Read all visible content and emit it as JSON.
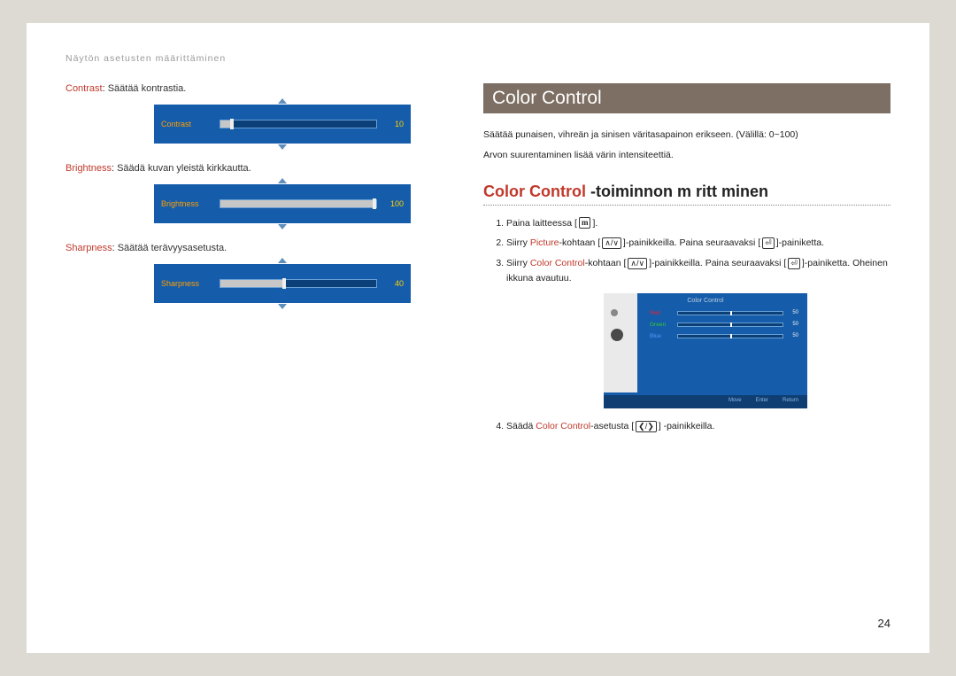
{
  "breadcrumb": "Näytön asetusten määrittäminen",
  "left": {
    "items": [
      {
        "key": "Contrast",
        "desc": ": Säätää kontrastia.",
        "label": "Contrast",
        "value": "10",
        "fill": 6,
        "knob": 6
      },
      {
        "key": "Brightness",
        "desc": ": Säädä kuvan yleistä kirkkautta.",
        "label": "Brightness",
        "value": "100",
        "fill": 100,
        "knob": 98
      },
      {
        "key": "Sharpness",
        "desc": ": Säätää terävyysasetusta.",
        "label": "Sharpness",
        "value": "40",
        "fill": 40,
        "knob": 40
      }
    ]
  },
  "right": {
    "title": "Color Control",
    "intro1": "Säätää punaisen, vihreän ja sinisen väritasapainon erikseen. (Välillä: 0~100)",
    "intro2": "Arvon suurentaminen lisää värin intensiteettiä.",
    "subhead_cc": "Color Control",
    "subhead_rest": "-toiminnon m  ritt minen",
    "steps": {
      "s1a": "Paina laitteessa [",
      "s1b": "].",
      "s2a": "Siirry ",
      "s2_pic": "Picture",
      "s2b": "-kohtaan [",
      "s2c": "]-painikkeilla. Paina seuraavaksi [",
      "s2d": "]-painiketta.",
      "s3a": "Siirry ",
      "s3_cc": "Color Control",
      "s3b": "-kohtaan [",
      "s3c": "]-painikkeilla. Paina seuraavaksi [",
      "s3d": "]-painiketta. Oheinen ikkuna avautuu.",
      "s4a": "Säädä ",
      "s4_cc": "Color Control",
      "s4b": "-asetusta [",
      "s4c": "] -painikkeilla."
    },
    "screenshot": {
      "title": "Color Control",
      "rows": [
        {
          "cls": "red",
          "label": "Red",
          "value": "50"
        },
        {
          "cls": "green",
          "label": "Green",
          "value": "50"
        },
        {
          "cls": "blue",
          "label": "Blue",
          "value": "50"
        }
      ],
      "foot": [
        "Move",
        "Enter",
        "Return"
      ]
    }
  },
  "icons": {
    "menu": "m",
    "updown": "∧/∨",
    "enter": "⏎",
    "leftright": "❮/❯"
  },
  "page_number": "24"
}
